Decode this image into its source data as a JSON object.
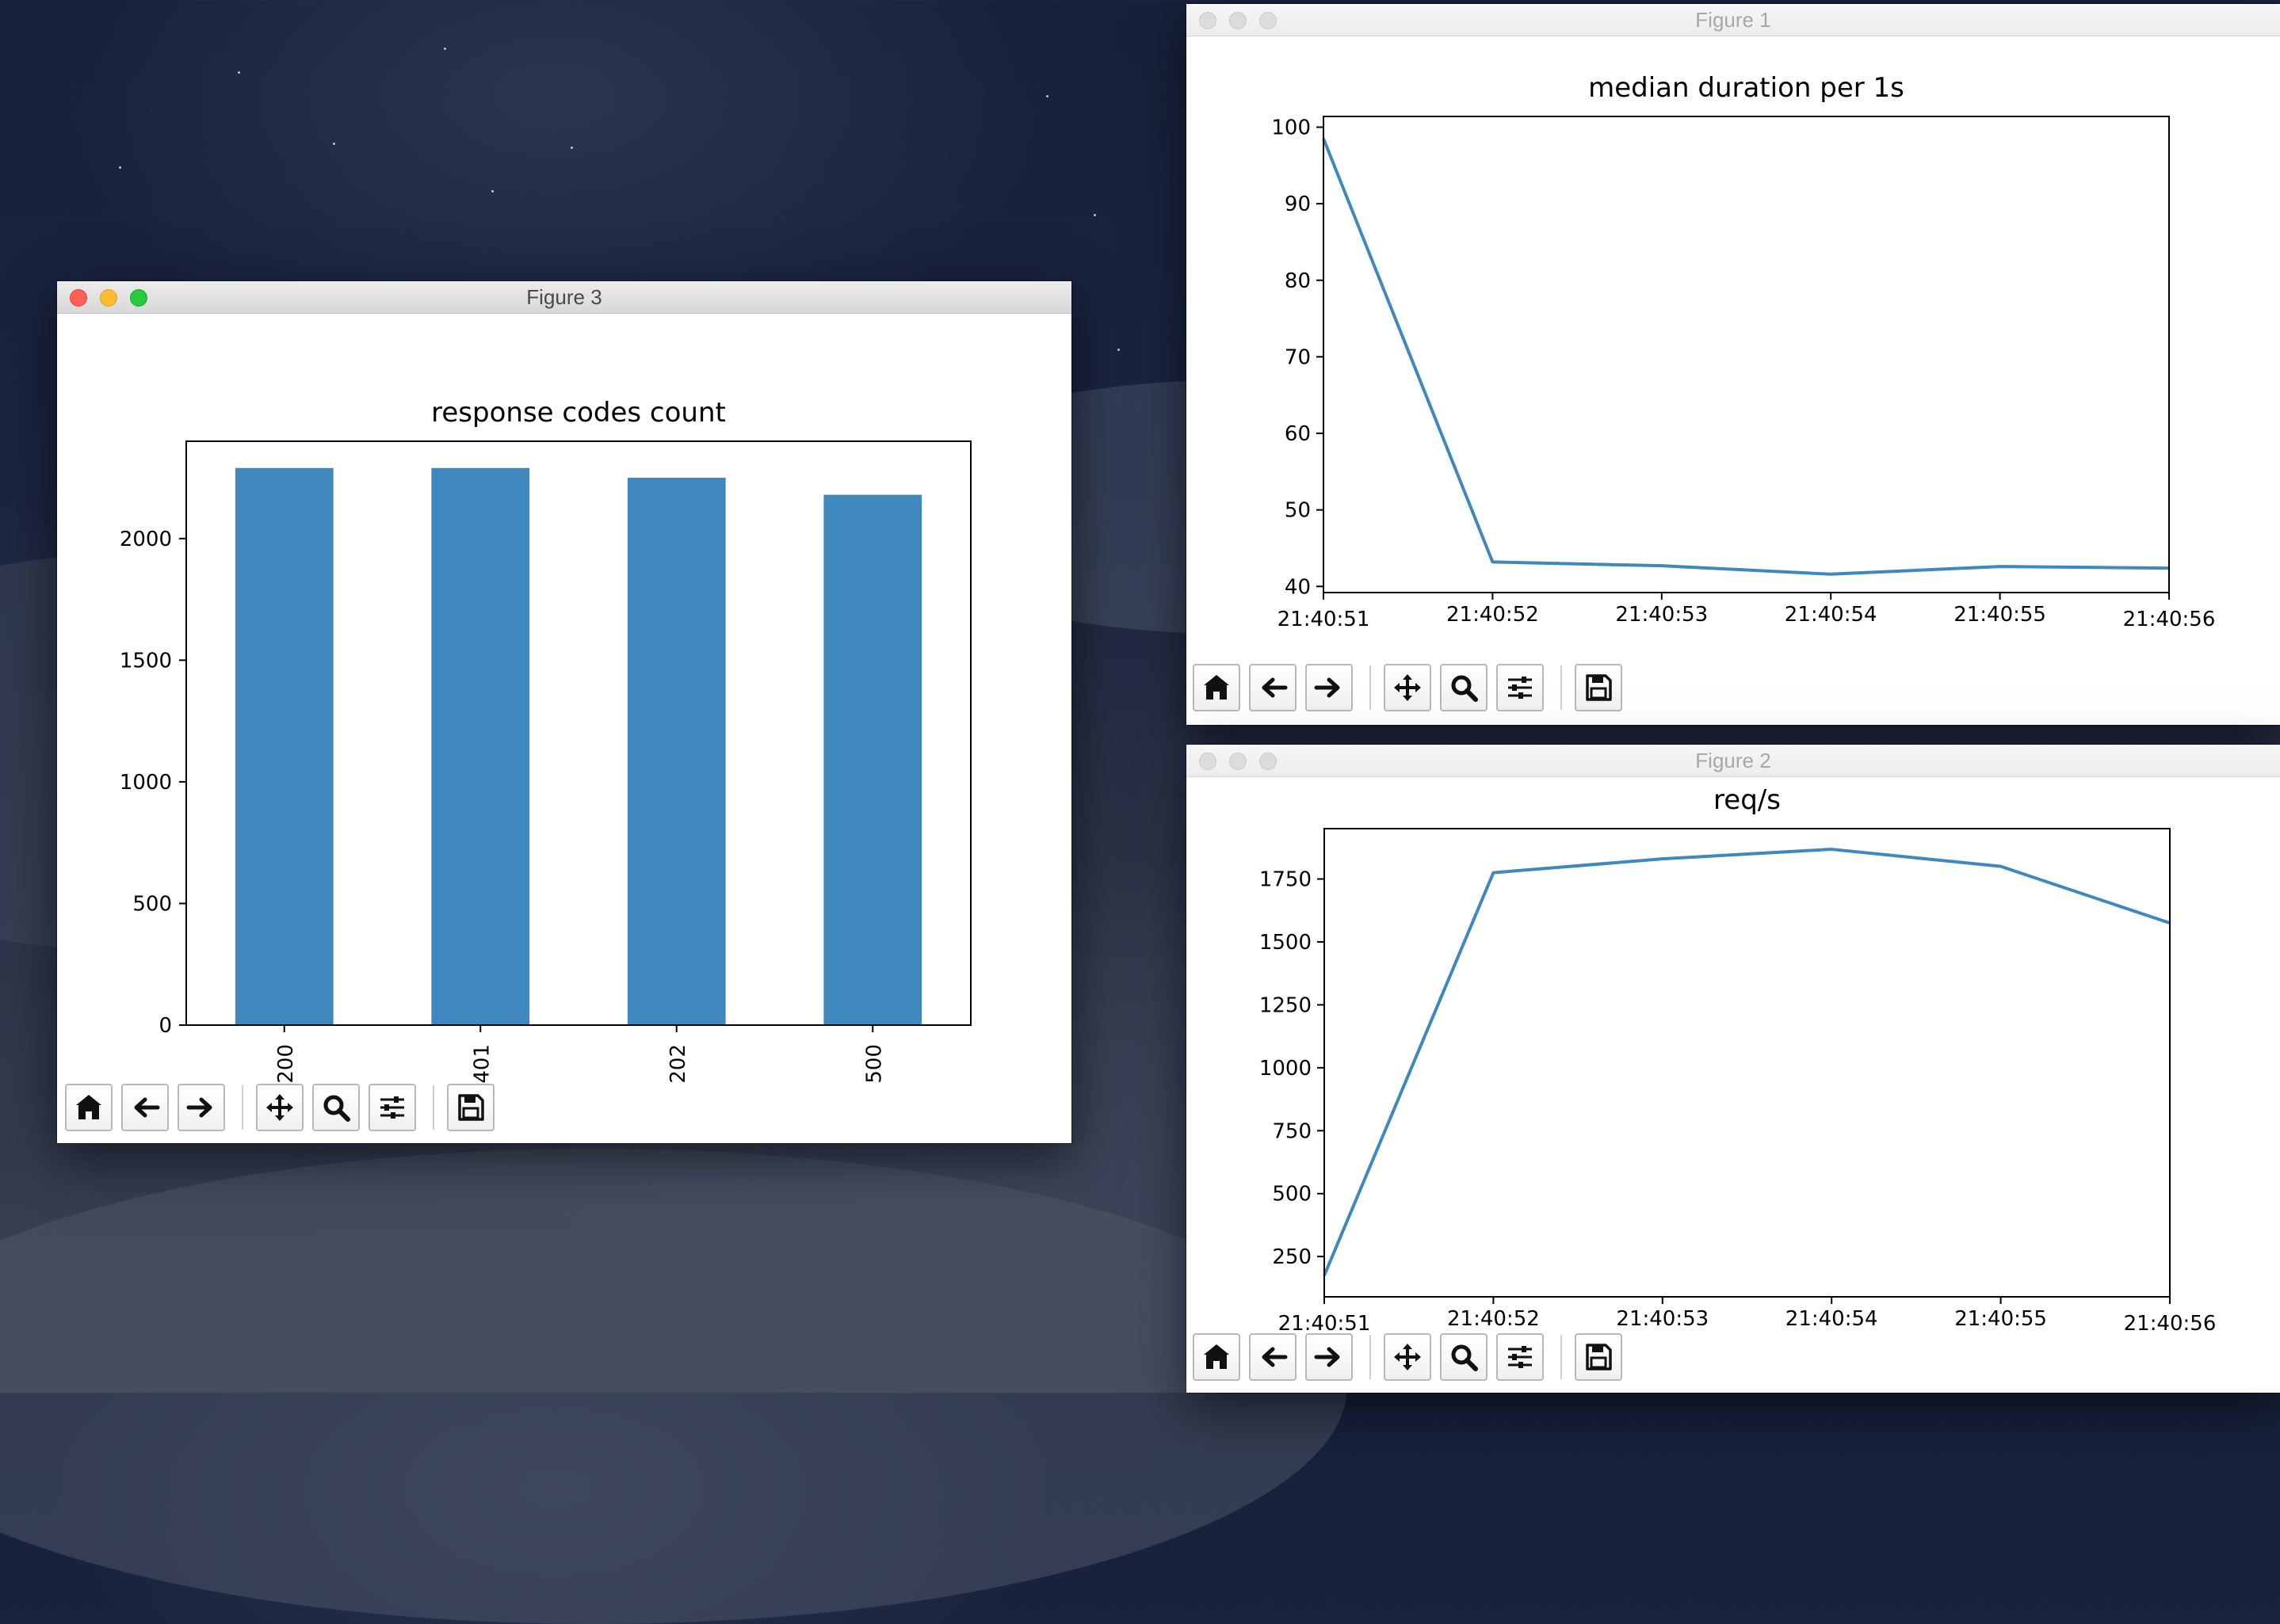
{
  "figure3": {
    "title": "Figure 3",
    "toolbar": [
      "home-icon",
      "back-icon",
      "forward-icon",
      "pan-icon",
      "zoom-icon",
      "configure-subplots-icon",
      "save-icon"
    ]
  },
  "figure1": {
    "title": "Figure 1",
    "toolbar": [
      "home-icon",
      "back-icon",
      "forward-icon",
      "pan-icon",
      "zoom-icon",
      "configure-subplots-icon",
      "save-icon"
    ]
  },
  "figure2": {
    "title": "Figure 2",
    "toolbar": [
      "home-icon",
      "back-icon",
      "forward-icon",
      "pan-icon",
      "zoom-icon",
      "configure-subplots-icon",
      "save-icon"
    ]
  },
  "chart_data": [
    {
      "type": "bar",
      "title": "response codes count",
      "categories": [
        "200",
        "401",
        "202",
        "500"
      ],
      "values": [
        2290,
        2290,
        2250,
        2180
      ],
      "ylim": [
        0,
        2400
      ],
      "yticks": [
        0,
        500,
        1000,
        1500,
        2000
      ],
      "tick_labels_rotated": true,
      "color": "#3f88bd"
    },
    {
      "type": "line",
      "title": "median duration per 1s",
      "x": [
        "21:40:51",
        "21:40:52",
        "21:40:53",
        "21:40:54",
        "21:40:55",
        "21:40:56"
      ],
      "values": [
        98.5,
        43.2,
        42.7,
        41.6,
        42.6,
        42.4
      ],
      "ylim": [
        39.2,
        101.4
      ],
      "yticks": [
        40,
        50,
        60,
        70,
        80,
        90,
        100
      ],
      "color": "#3f88bd"
    },
    {
      "type": "line",
      "title": "req/s",
      "x": [
        "21:40:51",
        "21:40:52",
        "21:40:53",
        "21:40:54",
        "21:40:55",
        "21:40:56"
      ],
      "values": [
        175,
        1775,
        1830,
        1868,
        1800,
        1575
      ],
      "ylim": [
        90,
        1950
      ],
      "yticks": [
        250,
        500,
        750,
        1000,
        1250,
        1500,
        1750
      ],
      "color": "#3f88bd"
    }
  ]
}
